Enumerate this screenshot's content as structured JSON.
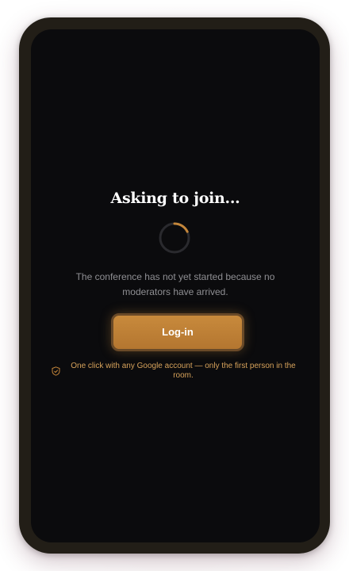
{
  "screen": {
    "title": "Asking to join...",
    "message": "The conference has not yet started because no moderators have arrived.",
    "login_label": "Log-in",
    "note_text": "One click with any Google account — only the first person in the room.",
    "note_icon": "shield-check-icon",
    "spinner_icon": "loading-spinner-icon"
  },
  "colors": {
    "accent": "#c4863a",
    "screen_background": "#0b0b0d",
    "device_frame": "#221e17",
    "title_text": "#ffffff",
    "message_text": "#8f8f93",
    "note_text": "#d6a25a"
  }
}
